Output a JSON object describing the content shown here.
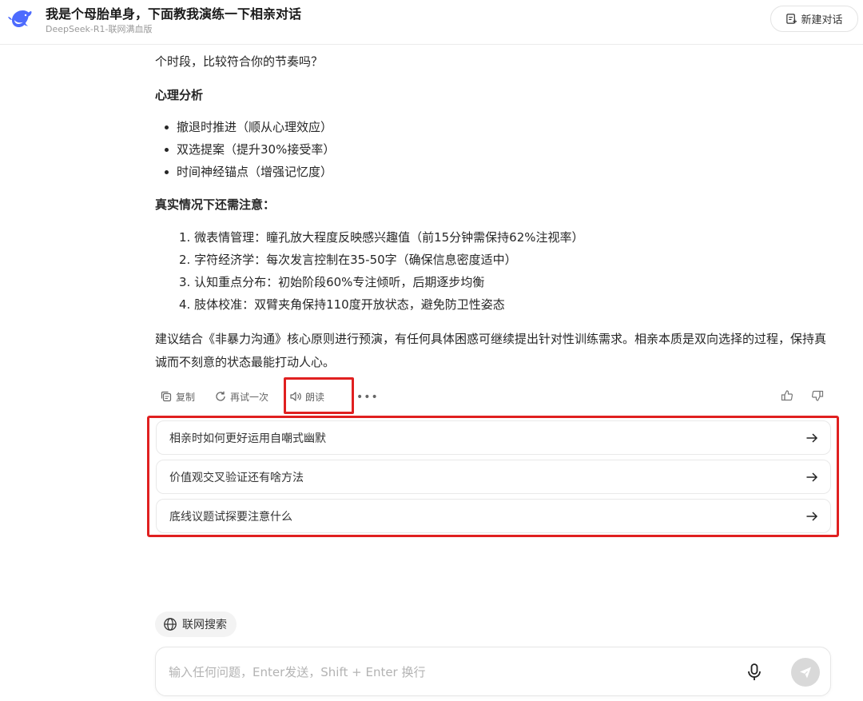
{
  "header": {
    "title": "我是个母胎单身，下面教我演练一下相亲对话",
    "subtitle": "DeepSeek-R1-联网满血版",
    "new_chat_label": "新建对话"
  },
  "content": {
    "intro_tail": "个时段，比较符合你的节奏吗？",
    "psych_heading": "心理分析",
    "psych_bullets": [
      "撤退时推进（顺从心理效应）",
      "双选提案（提升30%接受率）",
      "时间神经锚点（增强记忆度）"
    ],
    "notes_heading": "真实情况下还需注意：",
    "notes": [
      "1. 微表情管理：瞳孔放大程度反映感兴趣值（前15分钟需保持62%注视率）",
      "2. 字符经济学：每次发言控制在35-50字（确保信息密度适中）",
      "3. 认知重点分布：初始阶段60%专注倾听，后期逐步均衡",
      "4. 肢体校准：双臂夹角保持110度开放状态，避免防卫性姿态"
    ],
    "closing": "建议结合《非暴力沟通》核心原则进行预演，有任何具体困惑可继续提出针对性训练需求。相亲本质是双向选择的过程，保持真诚而不刻意的状态最能打动人心。"
  },
  "actions": {
    "copy": "复制",
    "retry": "再试一次",
    "read_aloud": "朗读"
  },
  "suggestions": [
    "相亲时如何更好运用自嘲式幽默",
    "价值观交叉验证还有啥方法",
    "底线议题试探要注意什么"
  ],
  "composer": {
    "web_search_label": "联网搜索",
    "placeholder": "输入任何问题，Enter发送，Shift + Enter 换行"
  },
  "colors": {
    "highlight": "#e02020",
    "brand": "#4d6bfe"
  }
}
